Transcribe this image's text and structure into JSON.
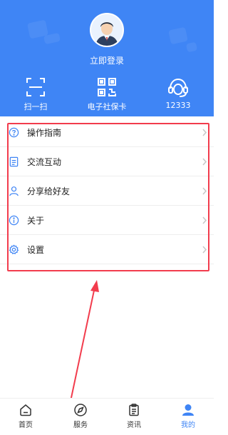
{
  "header": {
    "login_label": "立即登录",
    "quick_actions": [
      {
        "icon": "scan-icon",
        "label": "扫一扫"
      },
      {
        "icon": "qr-code-icon",
        "label": "电子社保卡"
      },
      {
        "icon": "headset-icon",
        "label": "12333"
      }
    ],
    "background_color": "#3f85f5"
  },
  "menu": {
    "items": [
      {
        "icon": "question-circle-icon",
        "label": "操作指南"
      },
      {
        "icon": "document-icon",
        "label": "交流互动"
      },
      {
        "icon": "person-icon",
        "label": "分享给好友"
      },
      {
        "icon": "info-circle-icon",
        "label": "关于"
      },
      {
        "icon": "gear-icon",
        "label": "设置"
      }
    ]
  },
  "annotation": {
    "highlight_color": "#f23c4d"
  },
  "tabbar": {
    "tabs": [
      {
        "icon": "home-icon",
        "label": "首页",
        "active": false
      },
      {
        "icon": "compass-icon",
        "label": "服务",
        "active": false
      },
      {
        "icon": "clipboard-icon",
        "label": "资讯",
        "active": false
      },
      {
        "icon": "profile-icon",
        "label": "我的",
        "active": true
      }
    ],
    "active_color": "#3f85f5"
  }
}
